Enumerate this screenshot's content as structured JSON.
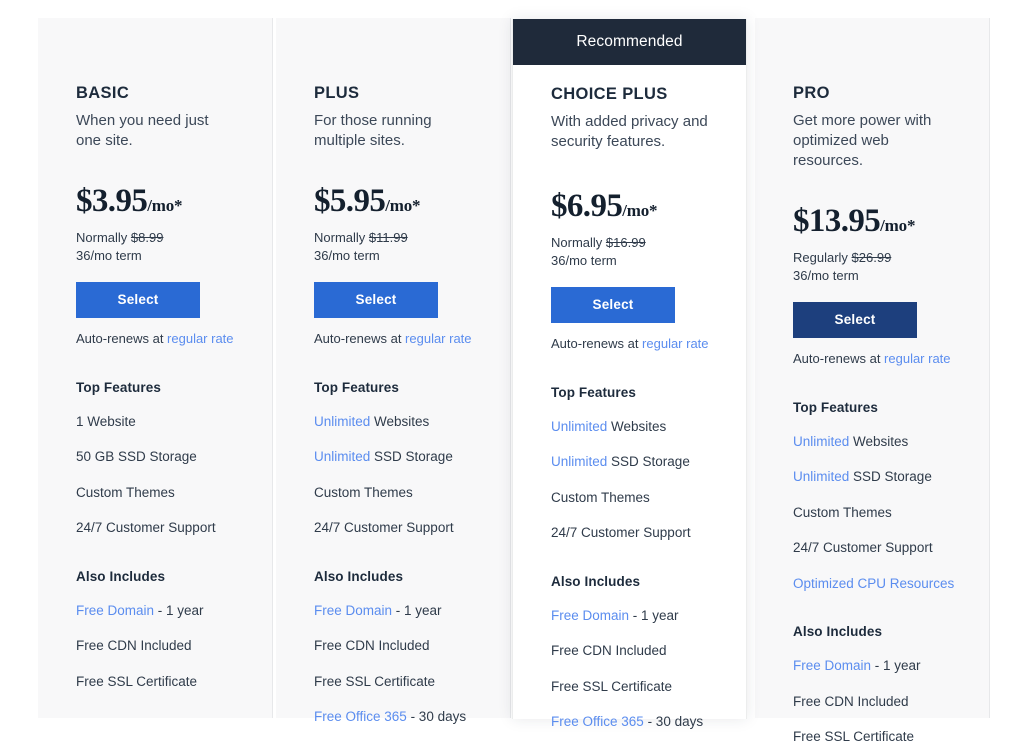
{
  "table": {
    "recommended_badge": "Recommended",
    "section_titles": {
      "top_features": "Top Features",
      "also_includes": "Also Includes"
    },
    "colors": {
      "accent_blue": "#2a6ad4",
      "accent_dark_blue": "#1d3f7d",
      "banner_navy": "#1f2a3a",
      "link_blue": "#5b8def",
      "card_bg": "#f8f8f9",
      "featured_bg": "#ffffff"
    }
  },
  "plans": [
    {
      "name": "BASIC",
      "description": "When you need just one site.",
      "price_amount": "$3.95",
      "price_suffix": "/mo*",
      "normally_label": "Normally",
      "normally_price": "$8.99",
      "term": "36/mo term",
      "select_label": "Select",
      "autorenew_prefix": "Auto-renews at ",
      "autorenew_link": "regular rate",
      "top_features": [
        {
          "highlight": "",
          "text": "1 Website"
        },
        {
          "highlight": "",
          "text": "50 GB SSD Storage"
        },
        {
          "highlight": "",
          "text": "Custom Themes"
        },
        {
          "highlight": "",
          "text": "24/7 Customer Support"
        }
      ],
      "also_includes": [
        {
          "highlight": "Free Domain",
          "text": " - 1 year"
        },
        {
          "highlight": "",
          "text": "Free CDN Included"
        },
        {
          "highlight": "",
          "text": "Free SSL Certificate"
        }
      ]
    },
    {
      "name": "PLUS",
      "description": "For those running multiple sites.",
      "price_amount": "$5.95",
      "price_suffix": "/mo*",
      "normally_label": "Normally",
      "normally_price": "$11.99",
      "term": "36/mo term",
      "select_label": "Select",
      "autorenew_prefix": "Auto-renews at ",
      "autorenew_link": "regular rate",
      "top_features": [
        {
          "highlight": "Unlimited",
          "text": " Websites"
        },
        {
          "highlight": "Unlimited",
          "text": " SSD Storage"
        },
        {
          "highlight": "",
          "text": "Custom Themes"
        },
        {
          "highlight": "",
          "text": "24/7 Customer Support"
        }
      ],
      "also_includes": [
        {
          "highlight": "Free Domain",
          "text": " - 1 year"
        },
        {
          "highlight": "",
          "text": "Free CDN Included"
        },
        {
          "highlight": "",
          "text": "Free SSL Certificate"
        },
        {
          "highlight": "Free Office 365",
          "text": " - 30 days"
        }
      ]
    },
    {
      "name": "CHOICE PLUS",
      "description": "With added privacy and security features.",
      "price_amount": "$6.95",
      "price_suffix": "/mo*",
      "normally_label": "Normally",
      "normally_price": "$16.99",
      "term": "36/mo term",
      "select_label": "Select",
      "autorenew_prefix": "Auto-renews at ",
      "autorenew_link": "regular rate",
      "top_features": [
        {
          "highlight": "Unlimited",
          "text": " Websites"
        },
        {
          "highlight": "Unlimited",
          "text": " SSD Storage"
        },
        {
          "highlight": "",
          "text": "Custom Themes"
        },
        {
          "highlight": "",
          "text": "24/7 Customer Support"
        }
      ],
      "also_includes": [
        {
          "highlight": "Free Domain",
          "text": " - 1 year"
        },
        {
          "highlight": "",
          "text": "Free CDN Included"
        },
        {
          "highlight": "",
          "text": "Free SSL Certificate"
        },
        {
          "highlight": "Free Office 365",
          "text": " - 30 days"
        }
      ]
    },
    {
      "name": "PRO",
      "description": "Get more power with optimized web resources.",
      "price_amount": "$13.95",
      "price_suffix": "/mo*",
      "normally_label": "Regularly",
      "normally_price": "$26.99",
      "term": "36/mo term",
      "select_label": "Select",
      "autorenew_prefix": "Auto-renews at ",
      "autorenew_link": "regular rate",
      "top_features": [
        {
          "highlight": "Unlimited",
          "text": " Websites"
        },
        {
          "highlight": "Unlimited",
          "text": " SSD Storage"
        },
        {
          "highlight": "",
          "text": "Custom Themes"
        },
        {
          "highlight": "",
          "text": "24/7 Customer Support"
        },
        {
          "highlight": "Optimized CPU Resources",
          "text": ""
        }
      ],
      "also_includes": [
        {
          "highlight": "Free Domain",
          "text": " - 1 year"
        },
        {
          "highlight": "",
          "text": "Free CDN Included"
        },
        {
          "highlight": "",
          "text": "Free SSL Certificate"
        }
      ]
    }
  ]
}
